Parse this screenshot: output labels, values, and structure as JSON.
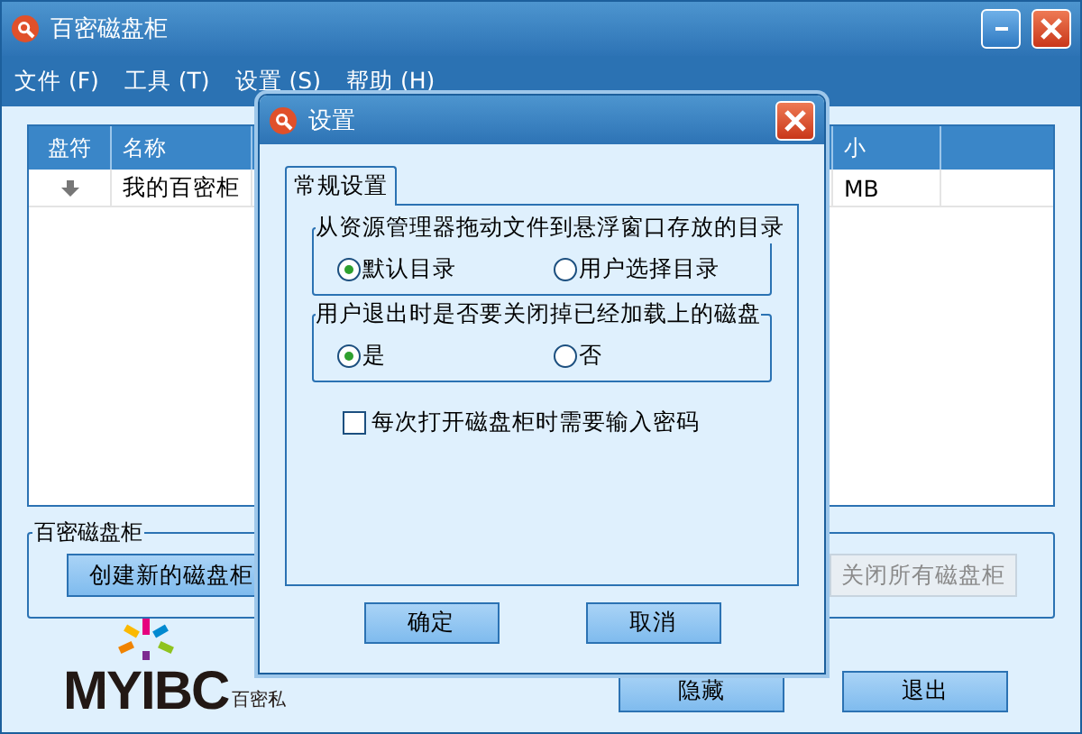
{
  "window": {
    "title": "百密磁盘柜"
  },
  "menu": [
    "文件 (F)",
    "工具 (T)",
    "设置 (S)",
    "帮助 (H)"
  ],
  "table": {
    "columns": [
      "盘符",
      "名称",
      "小"
    ],
    "rows": [
      {
        "name": "我的百密柜",
        "size": "MB"
      }
    ]
  },
  "group": {
    "title": "百密磁盘柜",
    "buttons": [
      {
        "label": "创建新的磁盘柜",
        "disabled": false
      },
      {
        "label": "关闭所有磁盘柜",
        "disabled": true
      }
    ]
  },
  "logo": {
    "text": "MYIBC",
    "subtitle": "百密私"
  },
  "bottom_buttons": [
    "隐藏",
    "退出"
  ],
  "dialog": {
    "title": "设置",
    "tab": {
      "label": "常规设置",
      "selected": true
    },
    "radio_groups": [
      {
        "title": "从资源管理器拖动文件到悬浮窗口存放的目录",
        "options": [
          {
            "label": "默认目录",
            "selected": true
          },
          {
            "label": "用户选择目录",
            "selected": false
          }
        ]
      },
      {
        "title": "用户退出时是否要关闭掉已经加载上的磁盘",
        "options": [
          {
            "label": "是",
            "selected": true
          },
          {
            "label": "否",
            "selected": false
          }
        ]
      }
    ],
    "checkbox": {
      "label": "每次打开磁盘柜时需要输入密码",
      "checked": false
    },
    "buttons": [
      "确定",
      "取消"
    ]
  }
}
